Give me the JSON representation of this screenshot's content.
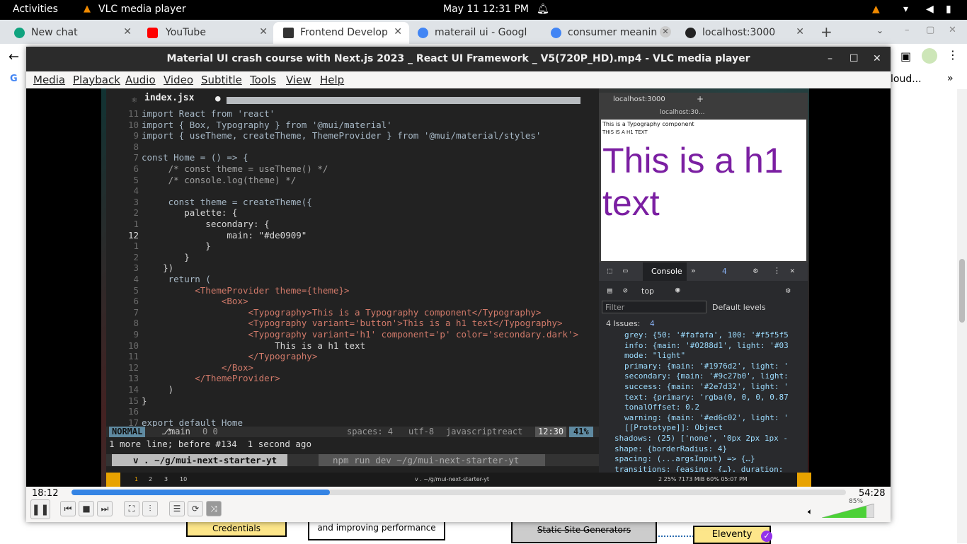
{
  "topbar": {
    "activities": "Activities",
    "app": "VLC media player",
    "datetime": "May 11  12:31 PM"
  },
  "tabs": [
    {
      "label": "New chat",
      "color": "#10a37f"
    },
    {
      "label": "YouTube",
      "color": "#ff0000"
    },
    {
      "label": "Frontend Develop",
      "color": "#333333"
    },
    {
      "label": "materail ui - Googl",
      "color": "#4285f4"
    },
    {
      "label": "consumer meanin",
      "color": "#4285f4"
    },
    {
      "label": "localhost:3000",
      "color": "#333333"
    }
  ],
  "bookmarks": {
    "overflow": "loud..."
  },
  "vlc": {
    "title": "Material UI crash course with Next.js 2023 _ React UI Framework _ V5(720P_HD).mp4 - VLC media player",
    "menu": [
      "Media",
      "Playback",
      "Audio",
      "Video",
      "Subtitle",
      "Tools",
      "View",
      "Help"
    ],
    "time_elapsed": "18:12",
    "time_total": "54:28",
    "progress": 0.334,
    "volume": "85%"
  },
  "editor": {
    "filename": "index.jsx",
    "mode": "NORMAL",
    "branch": "main",
    "diag": "0  0",
    "spaces": "spaces: 4",
    "encoding": "utf-8",
    "filetype": "javascriptreact",
    "position": "12:30",
    "percent": "41%",
    "message": "1 more line; before #134  1 second ago",
    "terminal1": "v . ~/g/mui-next-starter-yt",
    "terminal2": "npm run dev ~/g/mui-next-starter-yt",
    "tmux_title": "v . ~/g/mui-next-starter-yt",
    "tmux_right": "2  25%  7173 MiB  60%  05:07 PM",
    "tmux_tabs": [
      "1",
      "2",
      "3",
      "10"
    ],
    "lines": [
      {
        "n": "11",
        "code": "import React from 'react'"
      },
      {
        "n": "10",
        "code": "import { Box, Typography } from '@mui/material'"
      },
      {
        "n": "9",
        "code": "import { useTheme, createTheme, ThemeProvider } from '@mui/material/styles'"
      },
      {
        "n": "8",
        "code": ""
      },
      {
        "n": "7",
        "code": "const Home = () => {"
      },
      {
        "n": "6",
        "code": "     /* const theme = useTheme() */"
      },
      {
        "n": "5",
        "code": "     /* console.log(theme) */"
      },
      {
        "n": "4",
        "code": ""
      },
      {
        "n": "3",
        "code": "     const theme = createTheme({"
      },
      {
        "n": "2",
        "code": "        palette: {"
      },
      {
        "n": "1",
        "code": "            secondary: {"
      },
      {
        "n": "12",
        "code": "                main: \"#de0909\""
      },
      {
        "n": "1",
        "code": "            }"
      },
      {
        "n": "2",
        "code": "        }"
      },
      {
        "n": "3",
        "code": "    })"
      },
      {
        "n": "4",
        "code": "     return ("
      },
      {
        "n": "5",
        "code": "          <ThemeProvider theme={theme}>"
      },
      {
        "n": "6",
        "code": "               <Box>"
      },
      {
        "n": "7",
        "code": "                    <Typography>This is a Typography component</Typography>"
      },
      {
        "n": "8",
        "code": "                    <Typography variant='button'>This is a h1 text</Typography>"
      },
      {
        "n": "9",
        "code": "                    <Typography variant='h1' component='p' color='secondary.dark'>"
      },
      {
        "n": "10",
        "code": "                         This is a h1 text"
      },
      {
        "n": "11",
        "code": "                    </Typography>"
      },
      {
        "n": "12",
        "code": "               </Box>"
      },
      {
        "n": "13",
        "code": "          </ThemeProvider>"
      },
      {
        "n": "14",
        "code": "     )"
      },
      {
        "n": "15",
        "code": "}"
      },
      {
        "n": "16",
        "code": ""
      },
      {
        "n": "17",
        "code": "export default Home"
      }
    ]
  },
  "mini_browser": {
    "tab": "localhost:3000",
    "url": "localhost:30...",
    "line1": "This is a Typography component",
    "line2": "THIS IS A H1 TEXT",
    "h1": "This is a h1 text"
  },
  "devtools": {
    "tab": "Console",
    "issues_badge": "4",
    "context": "top",
    "filter": "Filter",
    "levels": "Default levels",
    "issues": "4 Issues:",
    "issues_count": "4",
    "rows": [
      "grey: {50: '#fafafa', 100: '#f5f5f5",
      "info: {main: '#0288d1', light: '#03",
      "mode: \"light\"",
      "primary: {main: '#1976d2', light: '",
      "secondary: {main: '#9c27b0', light:",
      "success: {main: '#2e7d32', light: '",
      "text: {primary: 'rgba(0, 0, 0, 0.87",
      "tonalOffset: 0.2",
      "warning: {main: '#ed6c02', light: '",
      "[[Prototype]]: Object",
      "shadows: (25) ['none', '0px 2px 1px -",
      "shape: {borderRadius: 4}",
      "spacing: (...argsInput) => {…}",
      "transitions: {easing: {…}, duration:"
    ]
  },
  "page": {
    "credentials": "Credentials",
    "perf": "and improving performance",
    "ssg": "Static Site Generators",
    "eleventy": "Eleventy"
  }
}
